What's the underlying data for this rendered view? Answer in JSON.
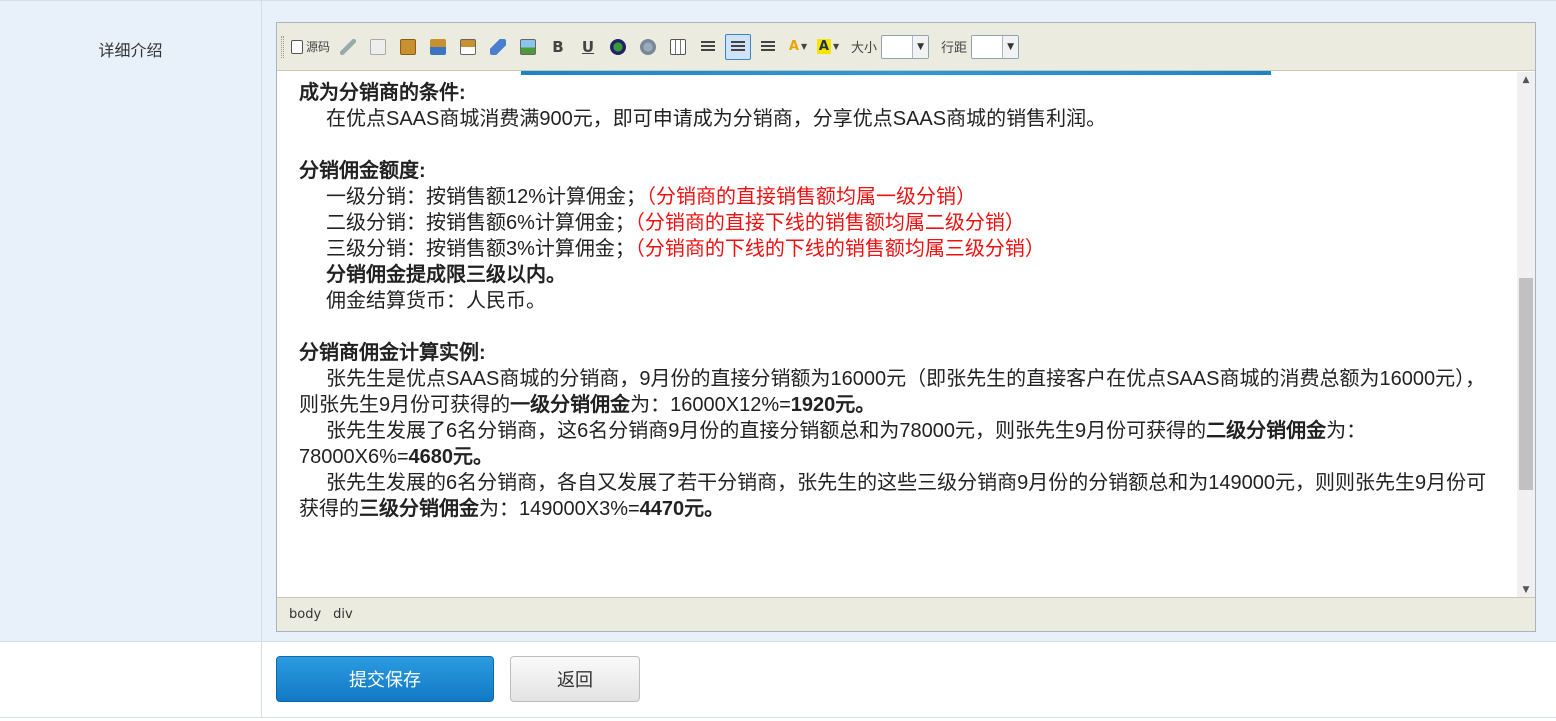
{
  "form": {
    "row_label": "详细介绍",
    "save_label": "提交保存",
    "back_label": "返回"
  },
  "toolbar": {
    "source_label": "源码",
    "bold_label": "B",
    "underline_label": "U",
    "font_color_label": "A",
    "bg_color_label": "A",
    "size_label": "大小",
    "size_value": "",
    "line_height_label": "行距",
    "line_height_value": "",
    "icons": [
      "source-icon",
      "cut-icon",
      "copy-icon",
      "paste-icon",
      "paste-text-icon",
      "paste-word-icon",
      "eraser-icon",
      "image-icon",
      "bold-icon",
      "underline-icon",
      "link-icon",
      "unlink-icon",
      "table-icon",
      "align-left-icon",
      "align-center-icon",
      "align-right-icon",
      "font-color-icon",
      "bg-color-icon"
    ],
    "active_tool": "align-center"
  },
  "content": {
    "h1": "成为分销商的条件:",
    "p1": "在优点SAAS商城消费满900元，即可申请成为分销商，分享优点SAAS商城的销售利润。",
    "h2": "分销佣金额度:",
    "l1a": "一级分销：按销售额12%计算佣金；",
    "l1b": "（分销商的直接销售额均属一级分销）",
    "l2a": "二级分销：按销售额6%计算佣金；",
    "l2b": "（分销商的直接下线的销售额均属二级分销）",
    "l3a": "三级分销：按销售额3%计算佣金；",
    "l3b": "（分销商的下线的下线的销售额均属三级分销）",
    "l4": "分销佣金提成限三级以内。",
    "l5": "佣金结算货币：人民币。",
    "h3": "分销商佣金计算实例:",
    "e1a": "张先生是优点SAAS商城的分销商，9月份的直接分销额为16000元（即张先生的直接客户在优点SAAS商城的消费总额为16000元），则张先生9月份可获得的",
    "e1b": "一级分销佣金",
    "e1c": "为：16000X12%=",
    "e1d": "1920元。",
    "e2a": "张先生发展了6名分销商，这6名分销商9月份的直接分销额总和为78000元，则张先生9月份可获得的",
    "e2b": "二级分销佣金",
    "e2c": "为：78000X6%=",
    "e2d": "4680元。",
    "e3a": "张先生发展的6名分销商，各自又发展了若干分销商，张先生的这些三级分销商9月份的分销额总和为149000元，则则张先生9月份可获得的",
    "e3b": "三级分销佣金",
    "e3c": "为：149000X3%=",
    "e3d": "4470元。"
  },
  "statusbar": {
    "path": [
      "body",
      "div"
    ]
  },
  "colors": {
    "row_bg": "#e8f1f9",
    "toolbar_bg": "#ecebdf",
    "highlight_red": "#ee1111",
    "primary_button": "#1a86d0"
  }
}
